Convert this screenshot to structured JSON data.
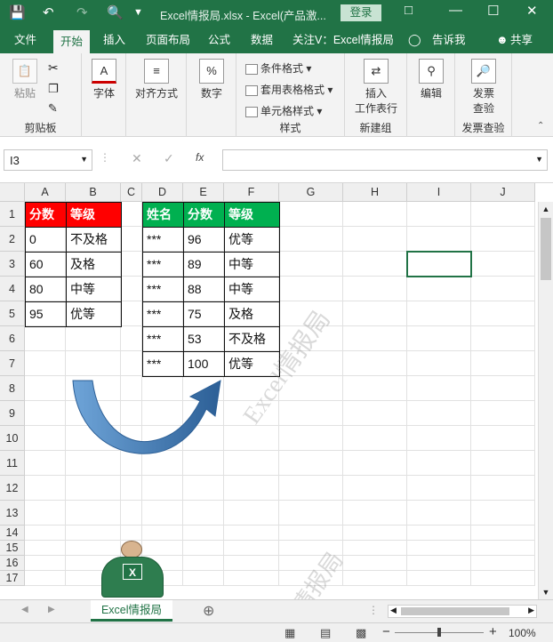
{
  "titlebar": {
    "doc_title": "Excel情报局.xlsx  -  Excel(产品激...",
    "login_label": "登录",
    "accent": "#217346"
  },
  "tabs": [
    "文件",
    "开始",
    "插入",
    "页面布局",
    "公式",
    "数据",
    "关注V：Excel情报局",
    "告诉我",
    "共享"
  ],
  "ribbon": {
    "clipboard": {
      "paste": "粘贴",
      "group": "剪贴板"
    },
    "font": {
      "label": "字体",
      "icon_glyph": "A"
    },
    "align": {
      "label": "对齐方式"
    },
    "number": {
      "label": "数字",
      "icon_glyph": "%"
    },
    "styles": {
      "cond": "条件格式",
      "table": "套用表格格式",
      "cell": "单元格样式",
      "group": "样式"
    },
    "insert": {
      "label": "插入",
      "label2": "工作表行",
      "group": "新建组"
    },
    "edit": {
      "label": "编辑"
    },
    "check": {
      "label": "发票",
      "label2": "查验",
      "group": "发票查验"
    }
  },
  "formula_bar": {
    "name_box": "I3",
    "fx": "fx"
  },
  "columns": [
    "A",
    "B",
    "C",
    "D",
    "E",
    "F",
    "G",
    "H",
    "I",
    "J"
  ],
  "rows": [
    "1",
    "2",
    "3",
    "4",
    "5",
    "6",
    "7",
    "8",
    "9",
    "10",
    "11",
    "12",
    "13",
    "14",
    "15",
    "16",
    "17"
  ],
  "table1": {
    "headers": [
      "分数",
      "等级"
    ],
    "rows": [
      [
        "0",
        "不及格"
      ],
      [
        "60",
        "及格"
      ],
      [
        "80",
        "中等"
      ],
      [
        "95",
        "优等"
      ]
    ],
    "header_color": "#ff0000"
  },
  "table2": {
    "headers": [
      "姓名",
      "分数",
      "等级"
    ],
    "rows": [
      [
        "***",
        "96",
        "优等"
      ],
      [
        "***",
        "89",
        "中等"
      ],
      [
        "***",
        "88",
        "中等"
      ],
      [
        "***",
        "75",
        "及格"
      ],
      [
        "***",
        "53",
        "不及格"
      ],
      [
        "***",
        "100",
        "优等"
      ]
    ],
    "header_color": "#00b050"
  },
  "watermarks": [
    "Excel情报局",
    "情报局"
  ],
  "logo_text": "X",
  "sheet": {
    "name": "Excel情报局",
    "add": "⊕"
  },
  "status": {
    "zoom": "100%",
    "minus": "−",
    "plus": "+"
  }
}
